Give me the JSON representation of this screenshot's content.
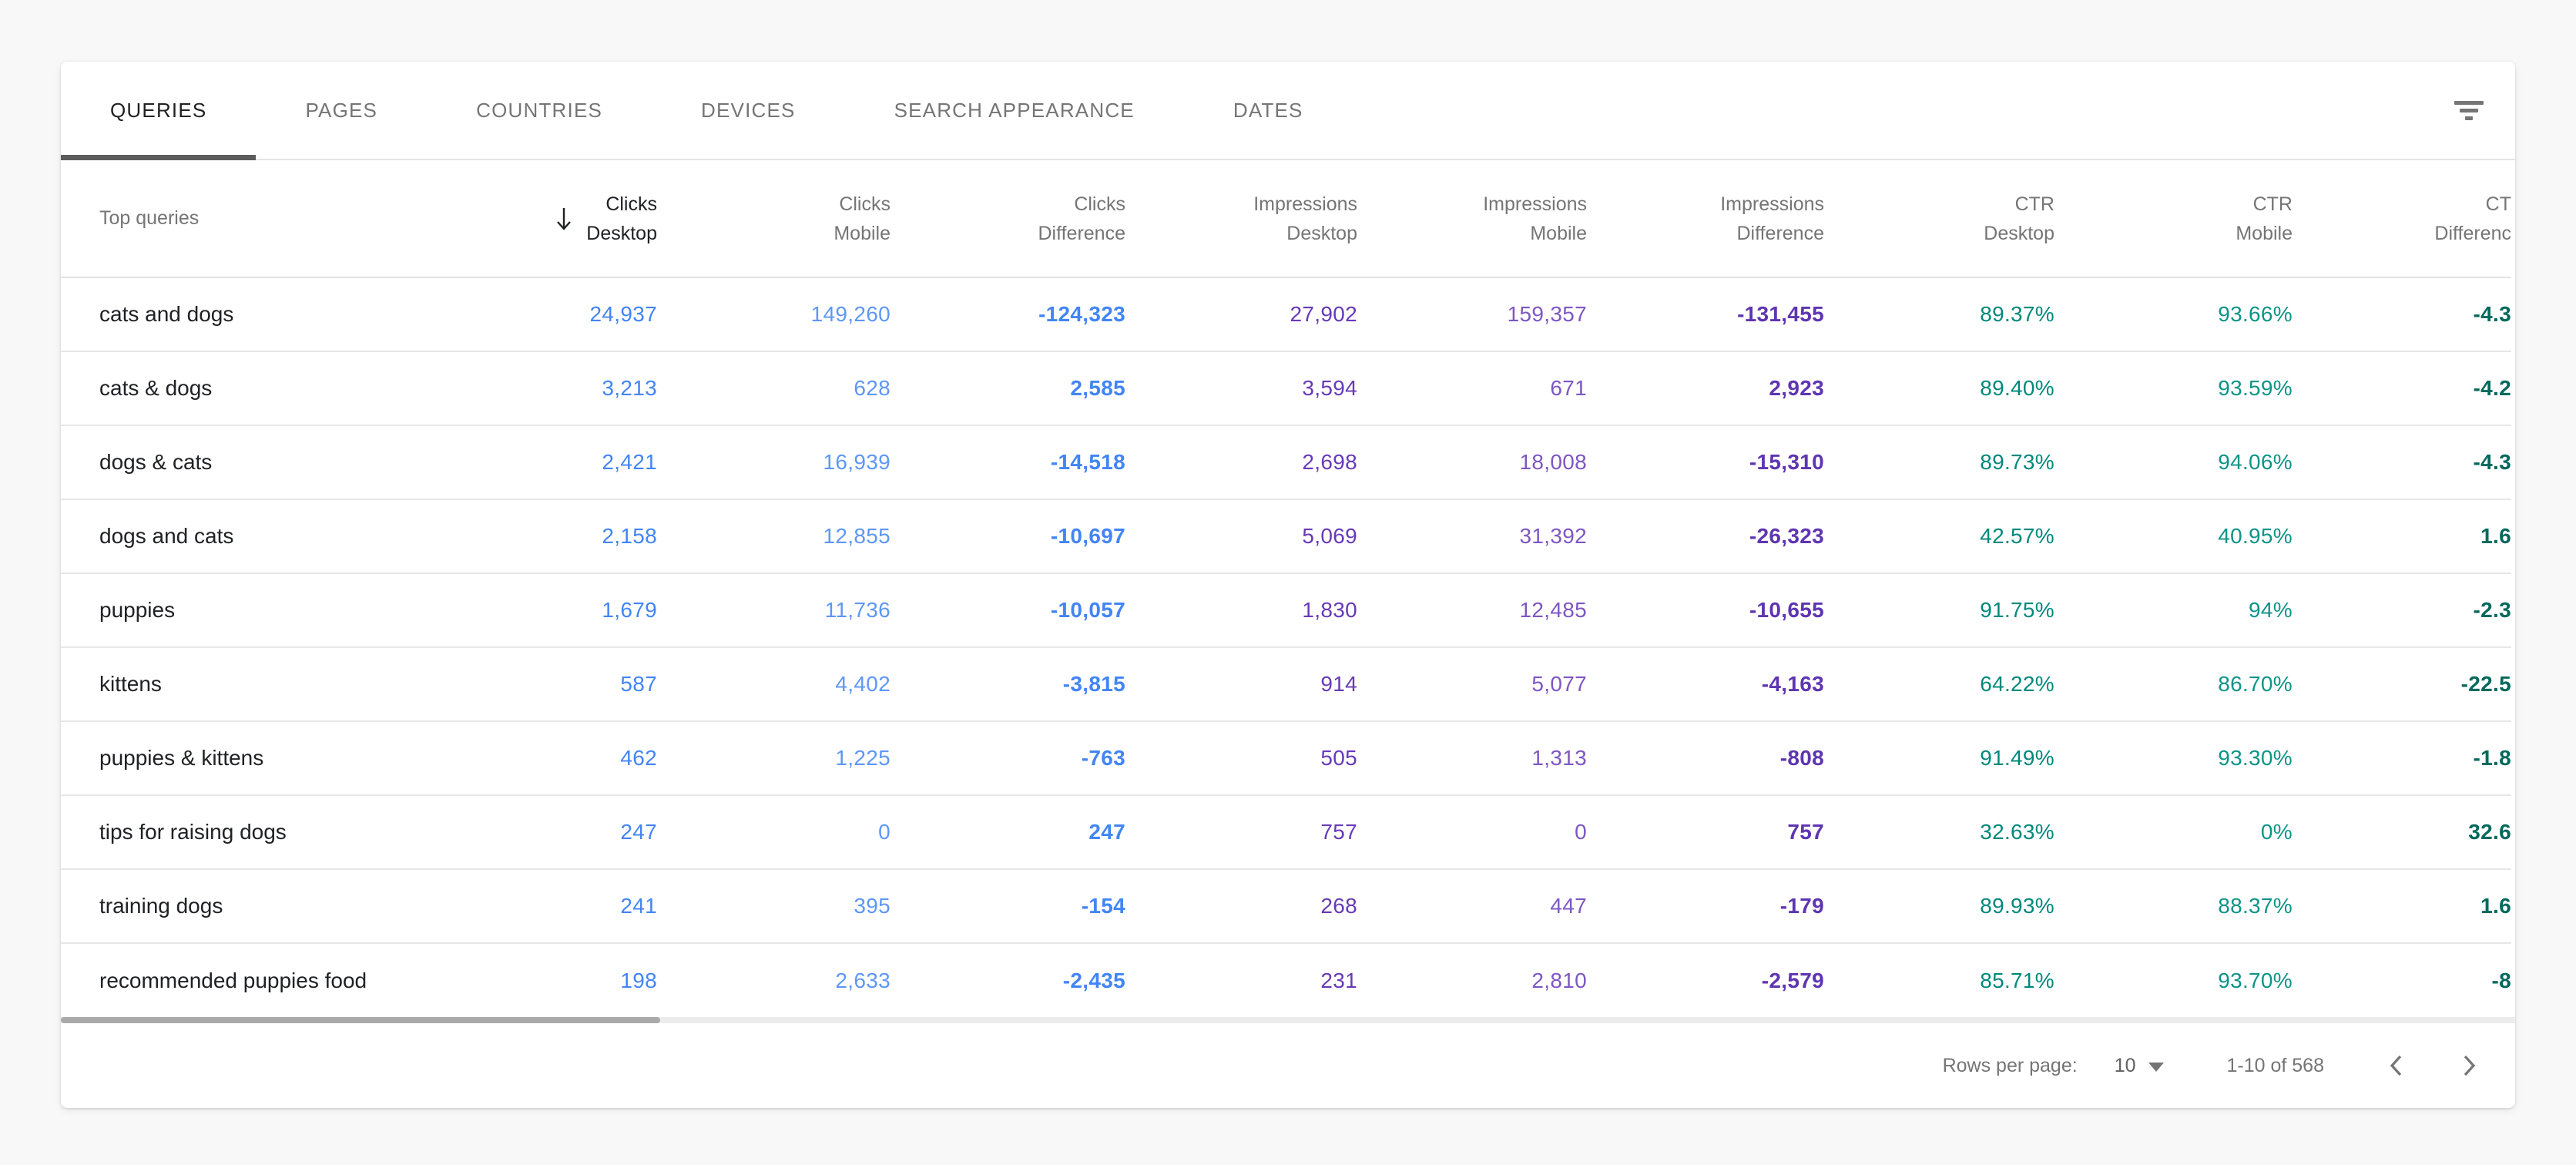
{
  "tabs": [
    {
      "label": "QUERIES",
      "active": true
    },
    {
      "label": "PAGES",
      "active": false
    },
    {
      "label": "COUNTRIES",
      "active": false
    },
    {
      "label": "DEVICES",
      "active": false
    },
    {
      "label": "SEARCH APPEARANCE",
      "active": false
    },
    {
      "label": "DATES",
      "active": false
    }
  ],
  "table": {
    "row_header": "Top queries",
    "columns": [
      {
        "line1": "Clicks",
        "line2": "Desktop",
        "sorted": true
      },
      {
        "line1": "Clicks",
        "line2": "Mobile"
      },
      {
        "line1": "Clicks",
        "line2": "Difference"
      },
      {
        "line1": "Impressions",
        "line2": "Desktop"
      },
      {
        "line1": "Impressions",
        "line2": "Mobile"
      },
      {
        "line1": "Impressions",
        "line2": "Difference"
      },
      {
        "line1": "CTR",
        "line2": "Desktop"
      },
      {
        "line1": "CTR",
        "line2": "Mobile"
      },
      {
        "line1": "CT",
        "line2": "Differenc",
        "clipped": true
      }
    ],
    "metric_colors": [
      "#4285f4",
      "#5e97f6",
      "#4285f4",
      "#673ab7",
      "#7e57c2",
      "#5e35b1",
      "#00897b",
      "#0d9488",
      "#00695c"
    ],
    "metric_bold": [
      false,
      false,
      true,
      false,
      false,
      true,
      false,
      false,
      true
    ],
    "rows": [
      {
        "query": "cats and dogs",
        "values": [
          "24,937",
          "149,260",
          "-124,323",
          "27,902",
          "159,357",
          "-131,455",
          "89.37%",
          "93.66%",
          "-4.3"
        ]
      },
      {
        "query": "cats & dogs",
        "values": [
          "3,213",
          "628",
          "2,585",
          "3,594",
          "671",
          "2,923",
          "89.40%",
          "93.59%",
          "-4.2"
        ]
      },
      {
        "query": "dogs & cats",
        "values": [
          "2,421",
          "16,939",
          "-14,518",
          "2,698",
          "18,008",
          "-15,310",
          "89.73%",
          "94.06%",
          "-4.3"
        ]
      },
      {
        "query": "dogs and cats",
        "values": [
          "2,158",
          "12,855",
          "-10,697",
          "5,069",
          "31,392",
          "-26,323",
          "42.57%",
          "40.95%",
          "1.6"
        ]
      },
      {
        "query": "puppies",
        "values": [
          "1,679",
          "11,736",
          "-10,057",
          "1,830",
          "12,485",
          "-10,655",
          "91.75%",
          "94%",
          "-2.3"
        ]
      },
      {
        "query": "kittens",
        "values": [
          "587",
          "4,402",
          "-3,815",
          "914",
          "5,077",
          "-4,163",
          "64.22%",
          "86.70%",
          "-22.5"
        ]
      },
      {
        "query": "puppies & kittens",
        "values": [
          "462",
          "1,225",
          "-763",
          "505",
          "1,313",
          "-808",
          "91.49%",
          "93.30%",
          "-1.8"
        ]
      },
      {
        "query": "tips for raising dogs",
        "values": [
          "247",
          "0",
          "247",
          "757",
          "0",
          "757",
          "32.63%",
          "0%",
          "32.6"
        ]
      },
      {
        "query": "training dogs",
        "values": [
          "241",
          "395",
          "-154",
          "268",
          "447",
          "-179",
          "89.93%",
          "88.37%",
          "1.6"
        ]
      },
      {
        "query": "recommended puppies food",
        "values": [
          "198",
          "2,633",
          "-2,435",
          "231",
          "2,810",
          "-2,579",
          "85.71%",
          "93.70%",
          "-8"
        ]
      }
    ]
  },
  "footer": {
    "rows_per_page_label": "Rows per page:",
    "rows_per_page_value": "10",
    "range_label": "1-10 of 568"
  }
}
